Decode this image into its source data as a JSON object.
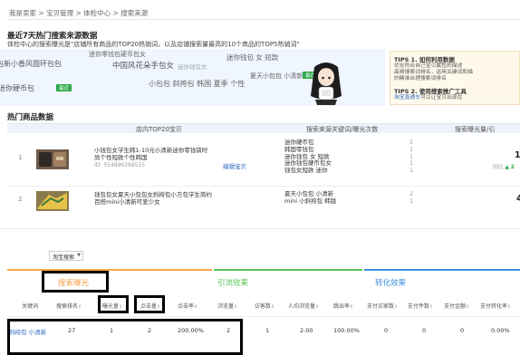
{
  "breadcrumb": [
    "我是卖家",
    "宝贝管理",
    "体检中心",
    "搜索来源"
  ],
  "breadcrumb_sep": ">",
  "hot_search": {
    "title": "最近7天热门搜索来源数据",
    "subtitle": "体检中心的搜索曝光是\"店铺所有商品的TOP20热销词，以及店铺搜索量最高的10个商品的TOP5热销词\"",
    "keywords": [
      "迷你零钱包硬币包女",
      "包新小香风圆环包包",
      "中国风花朵手包女",
      "迷你钱包 女 短款",
      "夏天小包包 小清新",
      "迷你硬币包",
      "小包包 斜挎包 韩国 夏季 个性",
      "迷你钱包女"
    ],
    "up_badge": "最近"
  },
  "tips": {
    "t1_title": "TIPS 1. 如何利用数据",
    "t1_body": [
      "优化符合自己宝贝属性的描述",
      "高频搜索词排名，运用关键词和描",
      "的精准合理搜索词排名"
    ],
    "t2_title": "TIPS 2. 使用搜索推广工具",
    "t2_link": "淘宝直通车",
    "t2_body": "可以让宝贝出现在"
  },
  "hot_products": {
    "title": "热门商品数据",
    "columns": [
      "店内TOP20宝贝",
      "搜索来源关键词/曝光次数",
      "搜索曝光量/引"
    ],
    "rows": [
      {
        "num": "1",
        "title_lines": [
          "小钱包女学生韩1-10元小清新迷你零钱袋时",
          "尚个性短款个性韩国"
        ],
        "id": "ID: 554896266515",
        "edit": "编辑宝贝",
        "sources": [
          "迷你硬币包",
          "韩国零钱包",
          "迷你钱包 女 短款",
          "迷你钱包硬币包女",
          "钱包女短款 迷你"
        ],
        "counts": [
          "2",
          "1",
          "1",
          "1",
          "1"
        ],
        "exposure": "14",
        "compare": "同比",
        "compare_value": "2"
      },
      {
        "num": "2",
        "title_lines": [
          "钱包包女夏天小包包女斜挎包小方包学生简约",
          "百搭mini小清新可爱少女"
        ],
        "sources": [
          "夏天小包包 小清新",
          "mini 小斜挎包 韩版"
        ],
        "counts": [
          "2",
          "1"
        ],
        "exposure": "4"
      }
    ]
  },
  "report": {
    "source_select": "淘宝搜索",
    "groups": [
      {
        "title": "搜索曝光",
        "color": "#f7a44a"
      },
      {
        "title": "引流效果",
        "color": "#5cc35c"
      },
      {
        "title": "转化效果",
        "color": "#3d8fe0"
      }
    ],
    "columns": [
      "关键词",
      "搜索排名",
      "曝光量",
      "点击量",
      "点击率",
      "浏览量",
      "访客数",
      "人均浏览量",
      "跳出率",
      "支付买家数",
      "支付件数",
      "支付金额",
      "支付转化率"
    ],
    "row": [
      "斜挎包 小清新",
      "27",
      "1",
      "2",
      "200.00%",
      "2",
      "1",
      "2.00",
      "100.00%",
      "0",
      "0",
      "0",
      "0.00%"
    ]
  }
}
